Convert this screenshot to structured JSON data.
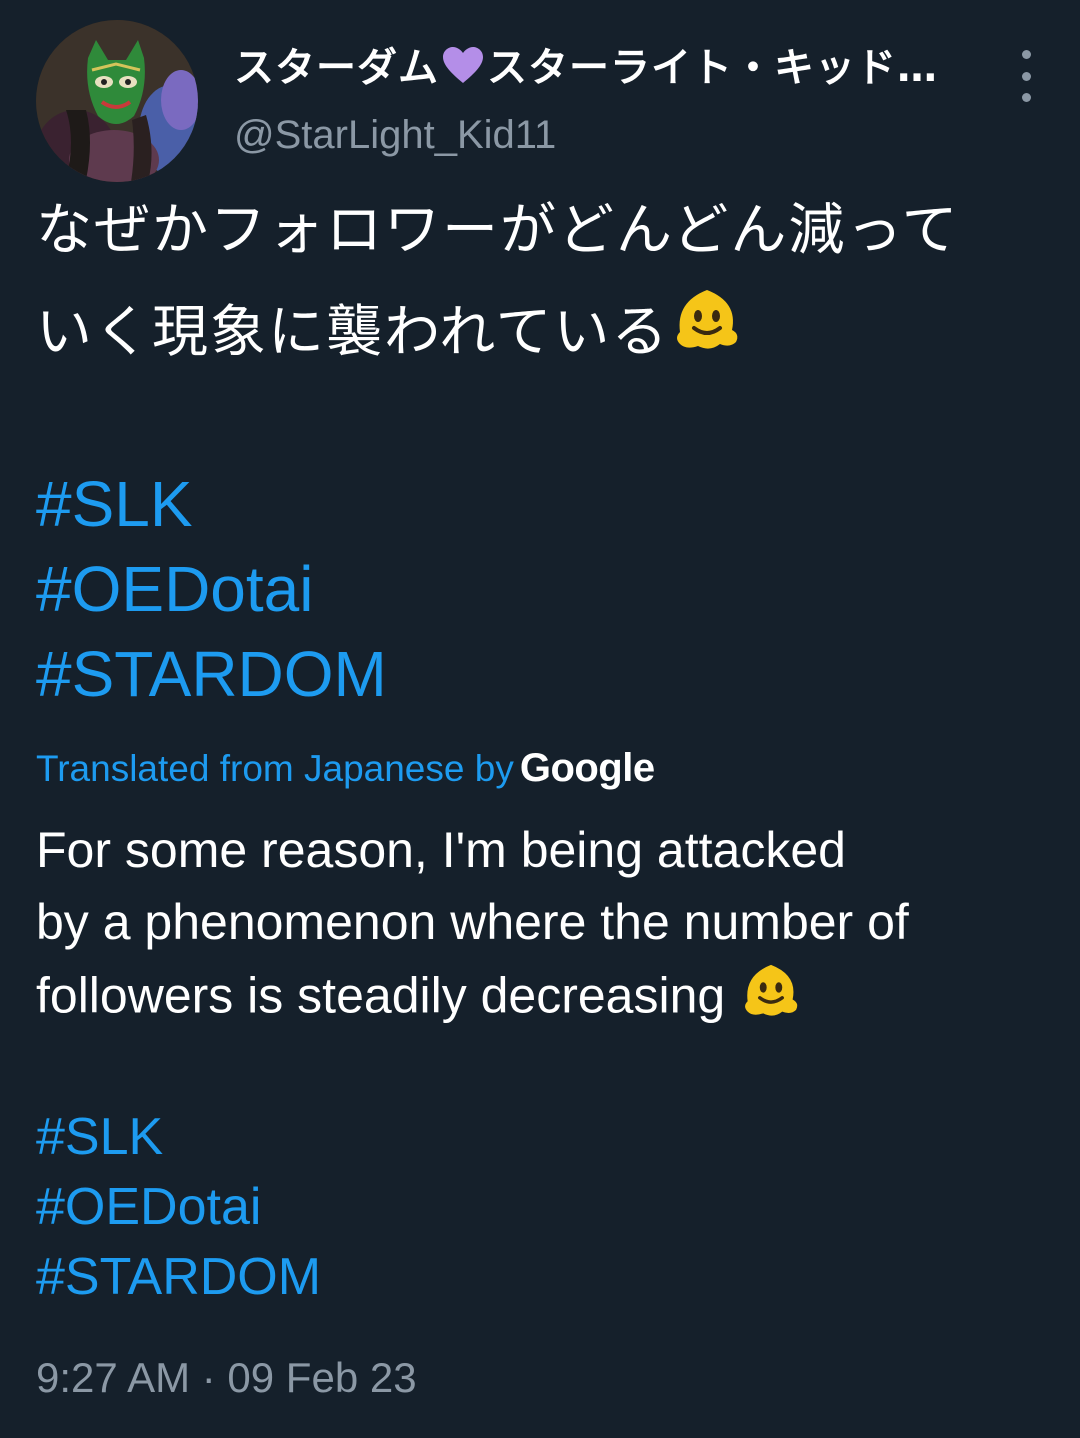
{
  "tweet": {
    "author": {
      "display_name_part1": "スターダム",
      "display_name_part2": "スターライト・キッド…",
      "handle": "@StarLight_Kid11",
      "avatar_icon": "avatar-icon",
      "heart_color": "#b48ee8"
    },
    "text_jp": {
      "line1": "なぜかフォロワーがどんどん減って",
      "line2": "いく現象に襲われている"
    },
    "hashtags_jp": [
      "#SLK",
      "#OEDotai",
      "#STARDOM"
    ],
    "translation": {
      "label": "Translated from Japanese by",
      "provider": "Google"
    },
    "text_en": {
      "line1": "For some reason, I'm being attacked",
      "line2": "by a phenomenon where the number of",
      "line3": "followers is steadily decreasing"
    },
    "hashtags_en": [
      "#SLK",
      "#OEDotai",
      "#STARDOM"
    ],
    "timestamp": "9:27 AM · 09 Feb 23",
    "colors": {
      "background": "#15202b",
      "link": "#1d9bf0",
      "secondary_text": "#8b98a5",
      "emoji": "#f5c518"
    },
    "emoji_icon": "melting-face-emoji"
  }
}
